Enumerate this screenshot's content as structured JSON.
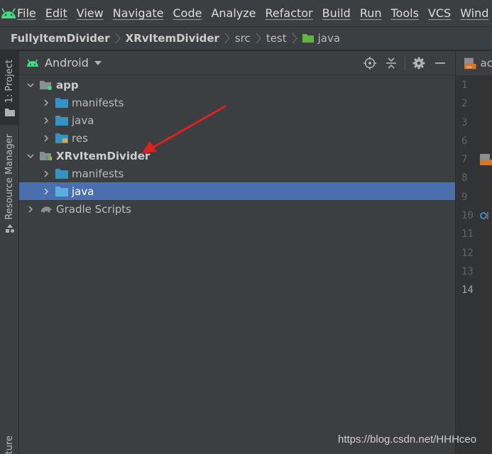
{
  "menu": [
    "File",
    "Edit",
    "View",
    "Navigate",
    "Code",
    "Analyze",
    "Refactor",
    "Build",
    "Run",
    "Tools",
    "VCS",
    "Wind"
  ],
  "breadcrumb": [
    "FullyItemDivider",
    "XRvItemDivider",
    "src",
    "test",
    "java"
  ],
  "tool_windows": {
    "project": "1: Project",
    "resource_manager": "Resource Manager",
    "structure": "ture"
  },
  "project_panel": {
    "view_mode": "Android",
    "tree": [
      {
        "label": "app",
        "level": 0,
        "expanded": true,
        "bold": true,
        "icon": "app-module-icon"
      },
      {
        "label": "manifests",
        "level": 1,
        "expanded": false,
        "icon": "folder-icon"
      },
      {
        "label": "java",
        "level": 1,
        "expanded": false,
        "icon": "folder-icon"
      },
      {
        "label": "res",
        "level": 1,
        "expanded": false,
        "icon": "res-folder-icon"
      },
      {
        "label": "XRvItemDivider",
        "level": 0,
        "expanded": true,
        "bold": true,
        "icon": "library-module-icon"
      },
      {
        "label": "manifests",
        "level": 1,
        "expanded": false,
        "icon": "folder-icon"
      },
      {
        "label": "java",
        "level": 1,
        "expanded": false,
        "icon": "folder-icon",
        "selected": true
      },
      {
        "label": "Gradle Scripts",
        "level": 0,
        "expanded": false,
        "icon": "gradle-icon"
      }
    ]
  },
  "editor": {
    "tab_label": "ac",
    "line_numbers": [
      "1",
      "2",
      "3",
      "6",
      "7",
      "8",
      "9",
      "10",
      "11",
      "12",
      "13",
      "14"
    ],
    "current_line": "14"
  },
  "watermark": "https://blog.csdn.net/HHHceo",
  "colors": {
    "selection": "#4b6eaf",
    "folder_blue": "#3592c4",
    "folder_green": "#62b543",
    "annotation_arrow": "#e02020",
    "android_green": "#3ddc84"
  }
}
